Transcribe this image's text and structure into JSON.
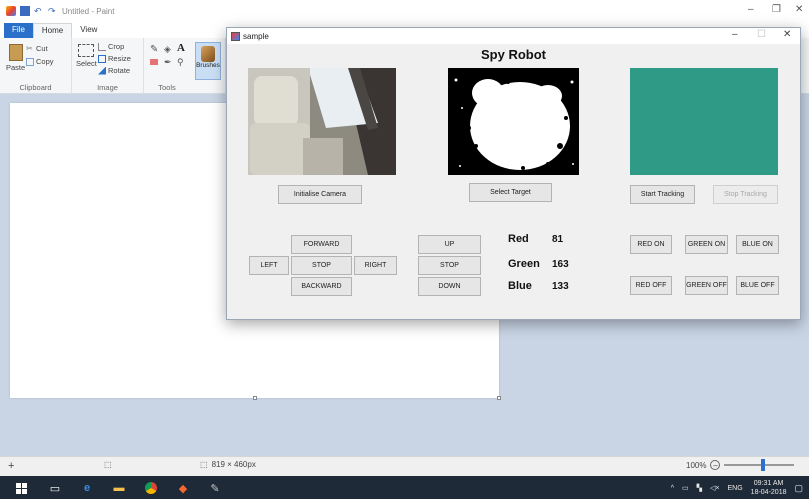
{
  "paint": {
    "window_title": "Untitled - Paint",
    "tabs": [
      "File",
      "Home",
      "View"
    ],
    "clipboard": {
      "paste": "Paste",
      "cut": "Cut",
      "copy": "Copy",
      "group": "Clipboard"
    },
    "image": {
      "select": "Select",
      "crop": "Crop",
      "resize": "Resize",
      "rotate": "Rotate",
      "group": "Image"
    },
    "tools": {
      "group": "Tools",
      "brushes": "Brushes"
    },
    "status": {
      "canvas_size": "819 × 460px",
      "zoom": "100%",
      "zoom_level": 0.55
    }
  },
  "taskbar": {
    "clock_time": "09:31 AM",
    "clock_date": "18-04-2018",
    "language": "ENG"
  },
  "app": {
    "window_title": "sample",
    "heading": "Spy Robot",
    "buttons": {
      "init_camera": "Initialise Camera",
      "select_target": "Select Target",
      "start_tracking": "Start Tracking",
      "stop_tracking": "Stop Tracking",
      "forward": "FORWARD",
      "left": "LEFT",
      "stop": "STOP",
      "right": "RIGHT",
      "backward": "BACKWARD",
      "up": "UP",
      "stop2": "STOP",
      "down": "DOWN",
      "red_on": "RED ON",
      "green_on": "GREEN ON",
      "blue_on": "BLUE ON",
      "red_off": "RED OFF",
      "green_off": "GREEN OFF",
      "blue_off": "BLUE OFF"
    },
    "rgb": {
      "red_label": "Red",
      "red_value": "81",
      "green_label": "Green",
      "green_value": "163",
      "blue_label": "Blue",
      "blue_value": "133"
    },
    "colors": {
      "tracked": "#2f9b86",
      "accent": "#2a6fc9"
    }
  }
}
